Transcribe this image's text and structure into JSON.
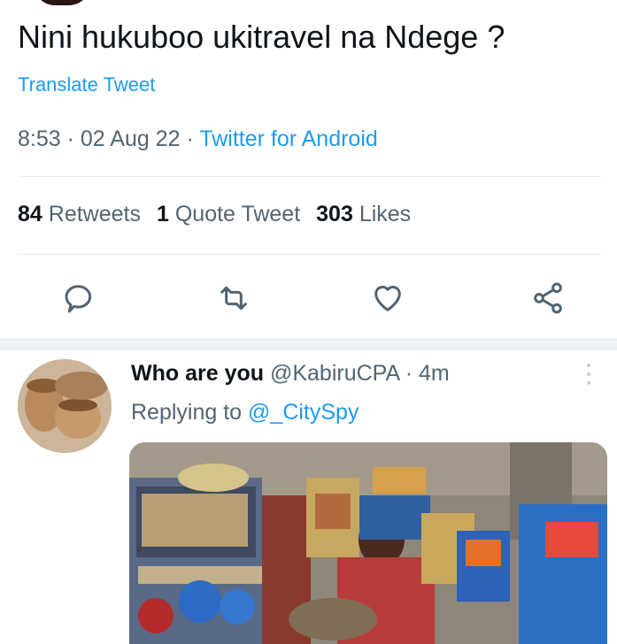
{
  "tweet": {
    "text": "Nini hukuboo ukitravel na Ndege ?",
    "translate_label": "Translate Tweet",
    "time": "8:53",
    "date": "02 Aug 22",
    "source": "Twitter for Android"
  },
  "stats": {
    "retweets_count": "84",
    "retweets_label": "Retweets",
    "quotes_count": "1",
    "quotes_label": "Quote Tweet",
    "likes_count": "303",
    "likes_label": "Likes"
  },
  "actions": {
    "reply": "reply-icon",
    "retweet": "retweet-icon",
    "like": "heart-icon",
    "share": "share-icon"
  },
  "reply": {
    "name": "Who are you",
    "handle": "@KabiruCPA",
    "time": "4m",
    "replying_prefix": "Replying to",
    "replying_to": "@_CitySpy"
  },
  "colors": {
    "accent": "#1d9bf0",
    "secondary_text": "#536471",
    "primary_text": "#0f1419"
  }
}
